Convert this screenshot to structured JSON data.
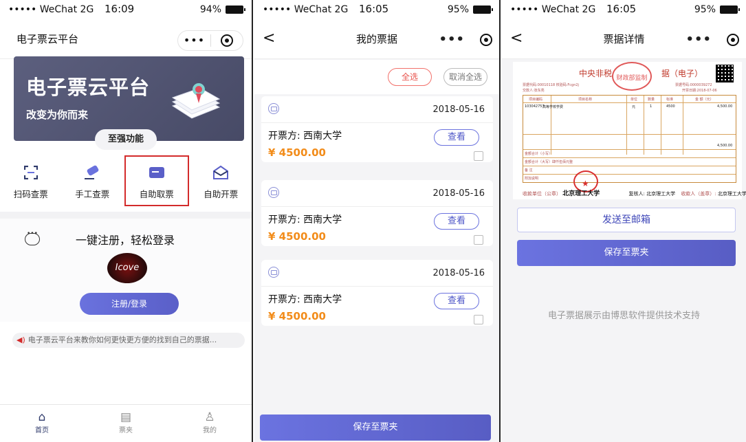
{
  "status": {
    "carrier": "••••• WeChat 2G",
    "time1": "16:09",
    "battery1": "94%",
    "time2": "16:05",
    "battery2": "95%",
    "time3": "16:05",
    "battery3": "95%"
  },
  "capsule": {
    "dots": "•••"
  },
  "home": {
    "app_title": "电子票云平台",
    "banner_title": "电子票云平台",
    "banner_sub": "改变为你而来",
    "feature_badge": "至强功能",
    "functions": [
      {
        "label": "扫码查票",
        "icon": "scan-icon"
      },
      {
        "label": "手工查票",
        "icon": "pen-icon"
      },
      {
        "label": "自助取票",
        "icon": "ticket-icon"
      },
      {
        "label": "自助开票",
        "icon": "mail-icon"
      }
    ],
    "register_title": "一键注册，轻松登录",
    "avatar_text": "Icove",
    "register_button": "注册/登录",
    "notice": "电子票云平台来教你如何更快更方便的找到自己的票据...",
    "tabs": [
      {
        "label": "首页",
        "icon": "home-icon"
      },
      {
        "label": "票夹",
        "icon": "wallet-icon"
      },
      {
        "label": "我的",
        "icon": "user-icon"
      }
    ]
  },
  "my_bills": {
    "title": "我的票据",
    "select_all": "全选",
    "deselect_all": "取消全选",
    "items": [
      {
        "date": "2018-05-16",
        "payer": "开票方: 西南大学",
        "amount": "¥ 4500.00",
        "view": "查看"
      },
      {
        "date": "2018-05-16",
        "payer": "开票方: 西南大学",
        "amount": "¥ 4500.00",
        "view": "查看"
      },
      {
        "date": "2018-05-16",
        "payer": "开票方: 西南大学",
        "amount": "¥ 4500.00",
        "view": "查看"
      }
    ],
    "save_button": "保存至票夹"
  },
  "detail": {
    "title": "票据详情",
    "invoice_title_left": "中央非税",
    "invoice_title_right": "据（电子）",
    "invoice_code": "票据代码:00010118  校验码:Fcgn2j",
    "invoice_no": "票据号码:0000039272",
    "payer_name": "交款人:张东亮",
    "issue_date": "开票日期:2018-07-06",
    "table_headers": [
      "项目编码",
      "项目名称",
      "单位",
      "数量",
      "标准",
      "金 额（元）"
    ],
    "item_code": "103042757",
    "item_name": "高等学校学费",
    "unit": "元",
    "qty": "1",
    "standard": "4500",
    "amount": "4,500.00",
    "total_label": "金额合计（小写）",
    "total_value": "4,500.00",
    "total_upper": "金额合计（大写）肆仟伍佰元整",
    "remark": "备 注",
    "extra": "附加说明",
    "payee_left_label": "收款单位（公章）",
    "payee_left": "北京理工大学",
    "reviewer": "复核人: 北京理工大学",
    "payee_right_label": "收款人（盖章）:",
    "payee_right": "北京理工大学",
    "seal_text": "财政部监制",
    "send_button": "发送至邮箱",
    "save_button": "保存至票夹",
    "support_text": "电子票据展示由博思软件提供技术支持"
  },
  "colors": {
    "brand": "#5a5fc8",
    "amount": "#f28c1a",
    "highlight": "#d32a2a",
    "banner": "#4f526f"
  }
}
